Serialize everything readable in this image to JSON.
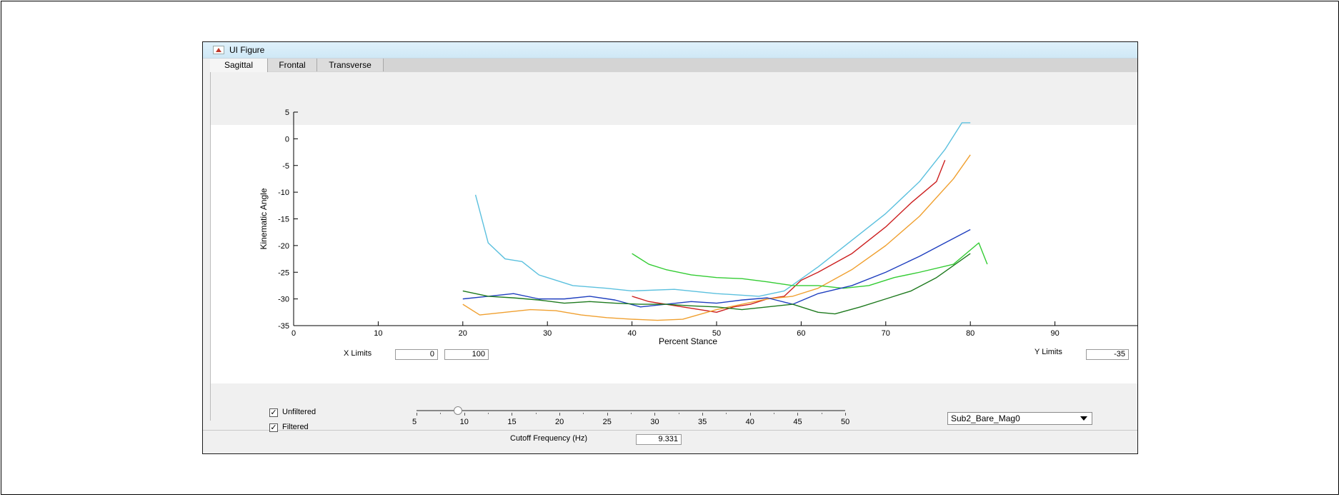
{
  "window": {
    "title": "UI Figure"
  },
  "tabs": [
    "Sagittal",
    "Frontal",
    "Transverse"
  ],
  "x_limits": {
    "label": "X Limits",
    "min": "0",
    "max": "100"
  },
  "y_limits": {
    "label": "Y Limits",
    "min": "-35"
  },
  "checkboxes": [
    {
      "label": "Unfiltered",
      "checked": true
    },
    {
      "label": "Filtered",
      "checked": true
    }
  ],
  "slider": {
    "min": 5,
    "max": 50,
    "value": 9.331,
    "ticks": [
      "5",
      "10",
      "15",
      "20",
      "25",
      "30",
      "35",
      "40",
      "45",
      "50"
    ]
  },
  "cutoff": {
    "label": "Cutoff Frequency (Hz)",
    "value": "9.331"
  },
  "dataset_dropdown": {
    "selected": "Sub2_Bare_Mag0"
  },
  "chart_data": {
    "type": "line",
    "xlabel": "Percent Stance",
    "ylabel": "Kinematic Angle",
    "xlim": [
      0,
      100
    ],
    "ylim": [
      -35,
      5
    ],
    "xticks": [
      0,
      10,
      20,
      30,
      40,
      50,
      60,
      70,
      80,
      90
    ],
    "yticks": [
      5,
      0,
      -5,
      -10,
      -15,
      -20,
      -25,
      -30,
      -35
    ],
    "series": [
      {
        "color": "#5bc0de",
        "x": [
          21.5,
          23,
          25,
          27,
          29,
          33,
          37,
          40,
          45,
          50,
          55,
          58,
          62,
          66,
          70,
          74,
          77,
          79,
          80
        ],
        "y": [
          -10.5,
          -19.5,
          -22.5,
          -23,
          -25.5,
          -27.5,
          -28,
          -28.5,
          -28.2,
          -29,
          -29.5,
          -28.5,
          -24,
          -19,
          -14,
          -8,
          -2,
          3,
          3
        ]
      },
      {
        "color": "#cc1f1f",
        "x": [
          40,
          42,
          44,
          46,
          48,
          50,
          52,
          54,
          56,
          58,
          60,
          62,
          66,
          70,
          73,
          76,
          77
        ],
        "y": [
          -29.5,
          -30.5,
          -31,
          -31.5,
          -32,
          -32.5,
          -31.5,
          -31,
          -30,
          -29.5,
          -26.5,
          -25,
          -21.5,
          -16.5,
          -12,
          -8,
          -4
        ]
      },
      {
        "color": "#f0a030",
        "x": [
          20,
          22,
          25,
          28,
          31,
          34,
          37,
          40,
          43,
          46,
          50,
          53,
          56,
          59,
          62,
          66,
          70,
          74,
          78,
          80
        ],
        "y": [
          -31,
          -33,
          -32.5,
          -32,
          -32.2,
          -33,
          -33.5,
          -33.8,
          -34,
          -33.8,
          -32,
          -31,
          -30,
          -29.5,
          -28,
          -24.5,
          -20,
          -14.5,
          -7.5,
          -3
        ]
      },
      {
        "color": "#33cc33",
        "x": [
          40,
          42,
          44,
          47,
          50,
          53,
          56,
          59,
          62,
          65,
          68,
          71,
          74,
          78,
          81,
          82
        ],
        "y": [
          -21.5,
          -23.5,
          -24.5,
          -25.5,
          -26,
          -26.2,
          -26.8,
          -27.5,
          -27.5,
          -28,
          -27.5,
          -26,
          -25,
          -23.5,
          -19.5,
          -23.5
        ]
      },
      {
        "color": "#1f3fbf",
        "x": [
          20,
          23,
          26,
          29,
          32,
          35,
          38,
          41,
          44,
          47,
          50,
          53,
          56,
          59,
          62,
          66,
          70,
          74,
          77,
          80
        ],
        "y": [
          -30,
          -29.5,
          -29,
          -30,
          -30,
          -29.5,
          -30.2,
          -31.5,
          -31,
          -30.5,
          -30.8,
          -30.2,
          -29.8,
          -31,
          -29,
          -27.5,
          -25,
          -22,
          -19.5,
          -17
        ]
      },
      {
        "color": "#1e7a1e",
        "x": [
          20,
          23,
          26,
          29,
          32,
          35,
          38,
          41,
          44,
          47,
          50,
          53,
          56,
          59,
          62,
          64,
          67,
          70,
          73,
          76,
          80
        ],
        "y": [
          -28.5,
          -29.5,
          -29.8,
          -30.2,
          -30.8,
          -30.5,
          -30.8,
          -31,
          -31,
          -31.3,
          -31.5,
          -32,
          -31.5,
          -31,
          -32.5,
          -32.8,
          -31.5,
          -30,
          -28.5,
          -26,
          -21.5
        ]
      }
    ]
  }
}
